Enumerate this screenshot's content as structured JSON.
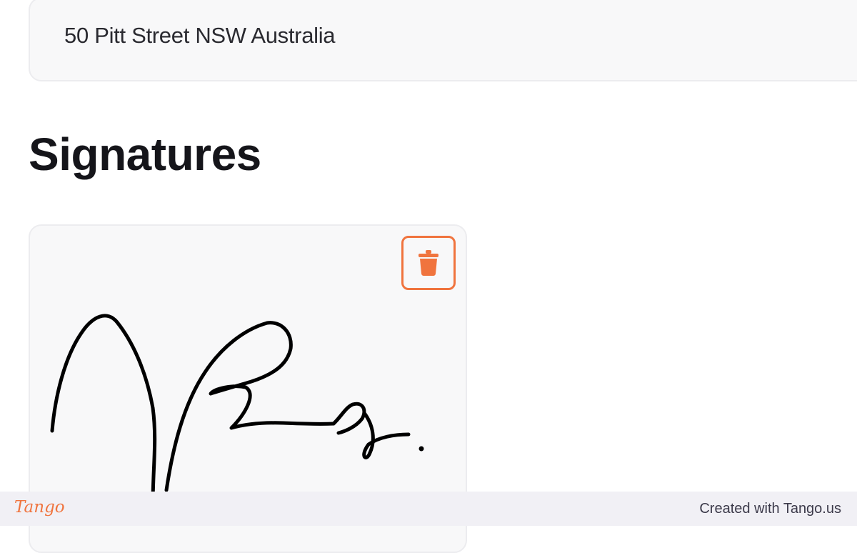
{
  "address": {
    "value": "50 Pitt Street NSW Australia"
  },
  "signatures": {
    "heading": "Signatures",
    "delete_icon": "trash-icon",
    "accent_color": "#f0743e"
  },
  "footer": {
    "logo": "Tango",
    "credit": "Created with Tango.us"
  }
}
